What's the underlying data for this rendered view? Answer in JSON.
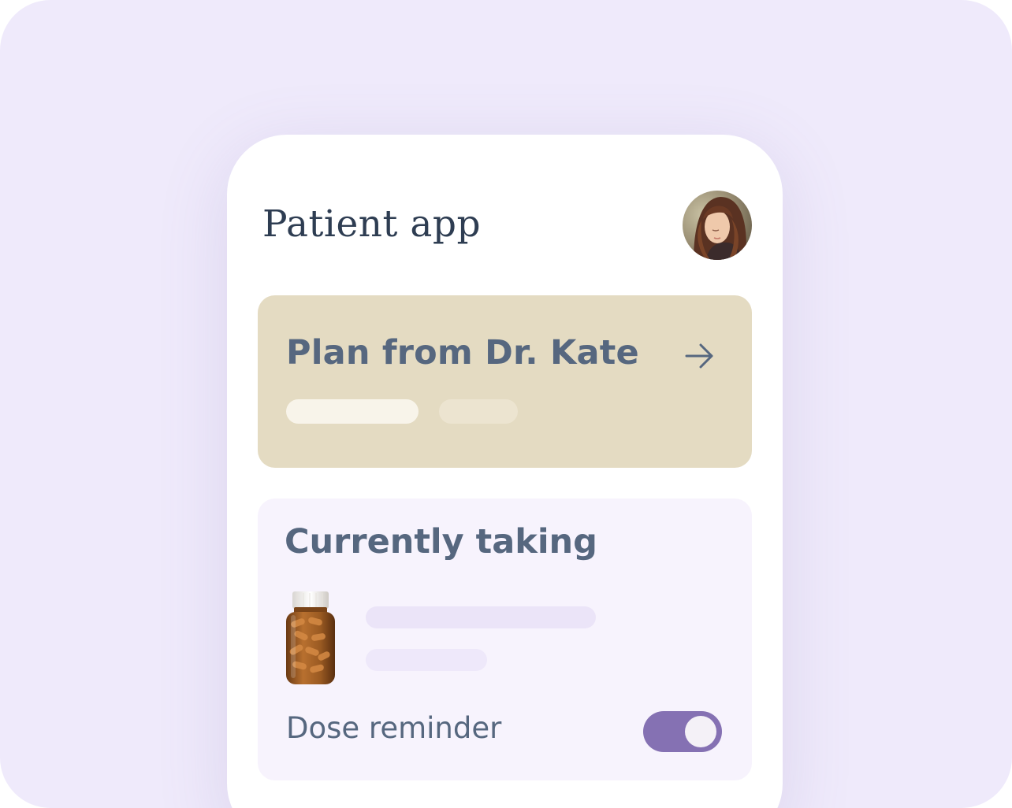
{
  "colors": {
    "background": "#efeafb",
    "phone": "#ffffff",
    "plan_card": "#e4dbc2",
    "taking_card": "#f7f3fd",
    "text_primary": "#2e3d52",
    "text_secondary": "#56677f",
    "toggle_on": "#8571b3"
  },
  "header": {
    "title": "Patient app",
    "avatar_icon": "user-avatar-photo"
  },
  "plan_card": {
    "title": "Plan from Dr. Kate",
    "arrow_icon": "arrow-right-icon"
  },
  "currently_taking": {
    "title": "Currently taking",
    "medication_icon": "pill-bottle-icon",
    "dose_reminder": {
      "label": "Dose reminder",
      "enabled": true
    }
  }
}
